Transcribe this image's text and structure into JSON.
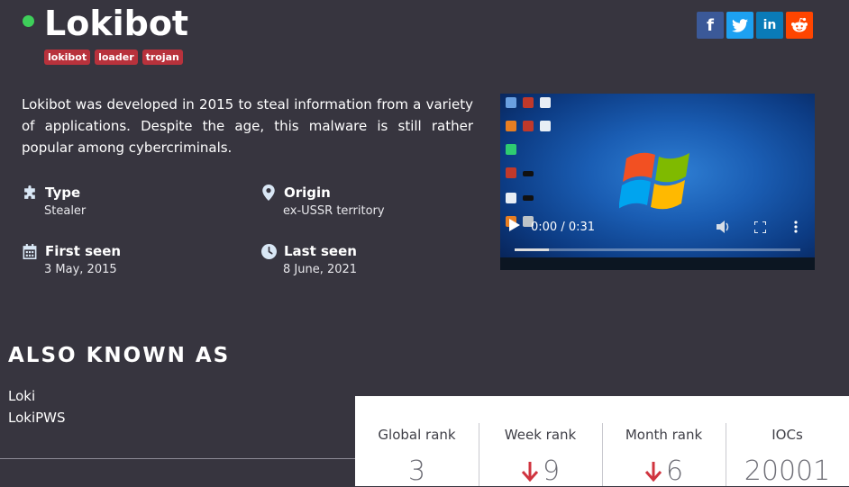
{
  "malware": {
    "name": "Lokibot",
    "status_color": "#3ecf5a",
    "tags": [
      "lokibot",
      "loader",
      "trojan"
    ],
    "description": "Lokibot was developed in 2015 to steal information from a variety of applications. Despite the age, this malware is still rather popular among cybercriminals."
  },
  "share": {
    "buttons": [
      {
        "name": "facebook-icon",
        "glyph": "f"
      },
      {
        "name": "twitter-icon",
        "glyph": ""
      },
      {
        "name": "linkedin-icon",
        "glyph": "in"
      },
      {
        "name": "reddit-icon",
        "glyph": ""
      }
    ]
  },
  "info": {
    "type_label": "Type",
    "type_value": "Stealer",
    "origin_label": "Origin",
    "origin_value": "ex-USSR territory",
    "first_seen_label": "First seen",
    "first_seen_value": "3 May, 2015",
    "last_seen_label": "Last seen",
    "last_seen_value": "8 June, 2021"
  },
  "video": {
    "time": "0:00 / 0:31",
    "progress": 0.0
  },
  "aka": {
    "heading": "ALSO KNOWN AS",
    "names": [
      "Loki",
      "LokiPWS"
    ]
  },
  "ranks": {
    "global_label": "Global rank",
    "global_value": "3",
    "week_label": "Week rank",
    "week_value": "9",
    "week_trend": "down",
    "month_label": "Month rank",
    "month_value": "6",
    "month_trend": "down",
    "iocs_label": "IOCs",
    "iocs_value": "20001"
  },
  "colors": {
    "background": "#37353f",
    "tag": "#b8323c",
    "trend_down": "#d0343f"
  }
}
